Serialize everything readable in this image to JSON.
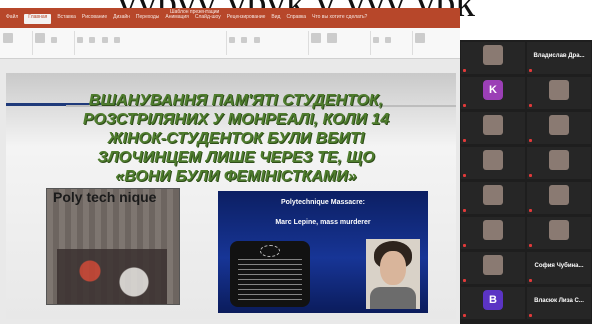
{
  "caption": "ууруу урук у ууу урк",
  "powerpoint": {
    "tabs": [
      "Файл",
      "Главная",
      "Вставка",
      "Рисование",
      "Дизайн",
      "Переходы",
      "Анимация",
      "Слайд-шоу",
      "Рецензирование",
      "Вид",
      "Справка",
      "Что вы хотите сделать?"
    ],
    "active_tab": "Главная",
    "window_title": "Шаблон презентации"
  },
  "slide": {
    "title": "ВШАНУВАННЯ ПАМ'ЯТІ СТУДЕНТОК,\nРОЗСТРІЛЯНИХ У МОНРЕАЛІ, КОЛИ 14\nЖІНОК-СТУДЕНТОК БУЛИ ВБИТІ\nЗЛОЧИНЦЕМ ЛИШЕ ЧЕРЕЗ ТЕ, ЩО\n«ВОНИ БУЛИ ФЕМІНІСТКАМИ»",
    "photo_sign": "Poly tech nique",
    "panel_line1": "Polytechnique Massacre:",
    "panel_line2": "Marc Lepine, mass murderer"
  },
  "participants": [
    {
      "kind": "photo",
      "label": "",
      "name": ""
    },
    {
      "kind": "text",
      "label": "Владислав Дра...",
      "name": ""
    },
    {
      "kind": "avatar",
      "label": "K",
      "color": "#9b3fb6",
      "name": ""
    },
    {
      "kind": "photo",
      "label": "",
      "name": ""
    },
    {
      "kind": "photo",
      "label": "",
      "name": ""
    },
    {
      "kind": "photo",
      "label": "",
      "name": ""
    },
    {
      "kind": "photo",
      "label": "",
      "name": ""
    },
    {
      "kind": "photo",
      "label": "",
      "name": ""
    },
    {
      "kind": "photo",
      "label": "",
      "name": ""
    },
    {
      "kind": "photo",
      "label": "",
      "name": ""
    },
    {
      "kind": "photo",
      "label": "",
      "name": ""
    },
    {
      "kind": "photo",
      "label": "",
      "name": ""
    },
    {
      "kind": "photo",
      "label": "",
      "name": ""
    },
    {
      "kind": "text",
      "label": "София Чубина...",
      "name": ""
    },
    {
      "kind": "avatar",
      "label": "B",
      "color": "#5b34c4",
      "name": ""
    },
    {
      "kind": "text",
      "label": "Власюк Лиза С...",
      "name": ""
    }
  ]
}
